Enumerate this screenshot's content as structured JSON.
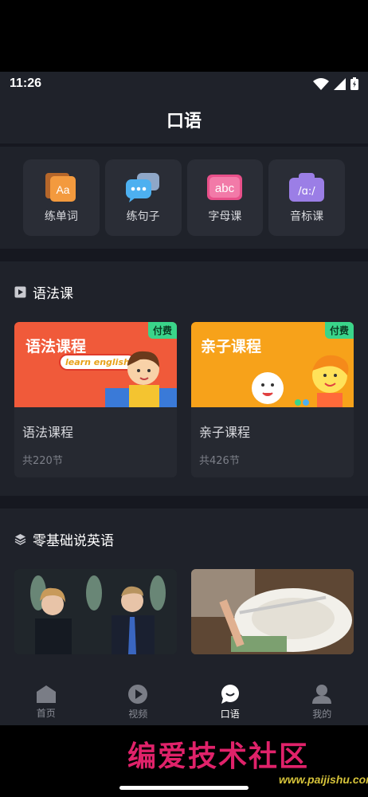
{
  "status": {
    "time": "11:26"
  },
  "header": {
    "title": "口语"
  },
  "tools": [
    {
      "label": "练单词",
      "icon": "flashcard-icon",
      "glyph": "Aa"
    },
    {
      "label": "练句子",
      "icon": "chat-bubbles-icon",
      "glyph": "•••"
    },
    {
      "label": "字母课",
      "icon": "abc-icon",
      "glyph": "abc"
    },
    {
      "label": "音标课",
      "icon": "phonetic-icon",
      "glyph": "/ɑ:/"
    }
  ],
  "grammar": {
    "title": "语法课",
    "cards": [
      {
        "thumb_title": "语法课程",
        "thumb_bubble": "learn english",
        "badge": "付费",
        "title": "语法课程",
        "sub": "共220节"
      },
      {
        "thumb_title": "亲子课程",
        "badge": "付费",
        "title": "亲子课程",
        "sub": "共426节"
      }
    ]
  },
  "basics": {
    "title": "零基础说英语"
  },
  "tabbar": [
    {
      "label": "首页",
      "icon": "home-icon"
    },
    {
      "label": "视频",
      "icon": "play-icon"
    },
    {
      "label": "口语",
      "icon": "speech-icon",
      "active": true
    },
    {
      "label": "我的",
      "icon": "profile-icon"
    }
  ],
  "watermark": {
    "text": "编爱技术社区",
    "url": "www.paijishu.com"
  },
  "colors": {
    "accent_green": "#3ad58a",
    "background": "#161820",
    "panel": "#1f222a"
  }
}
